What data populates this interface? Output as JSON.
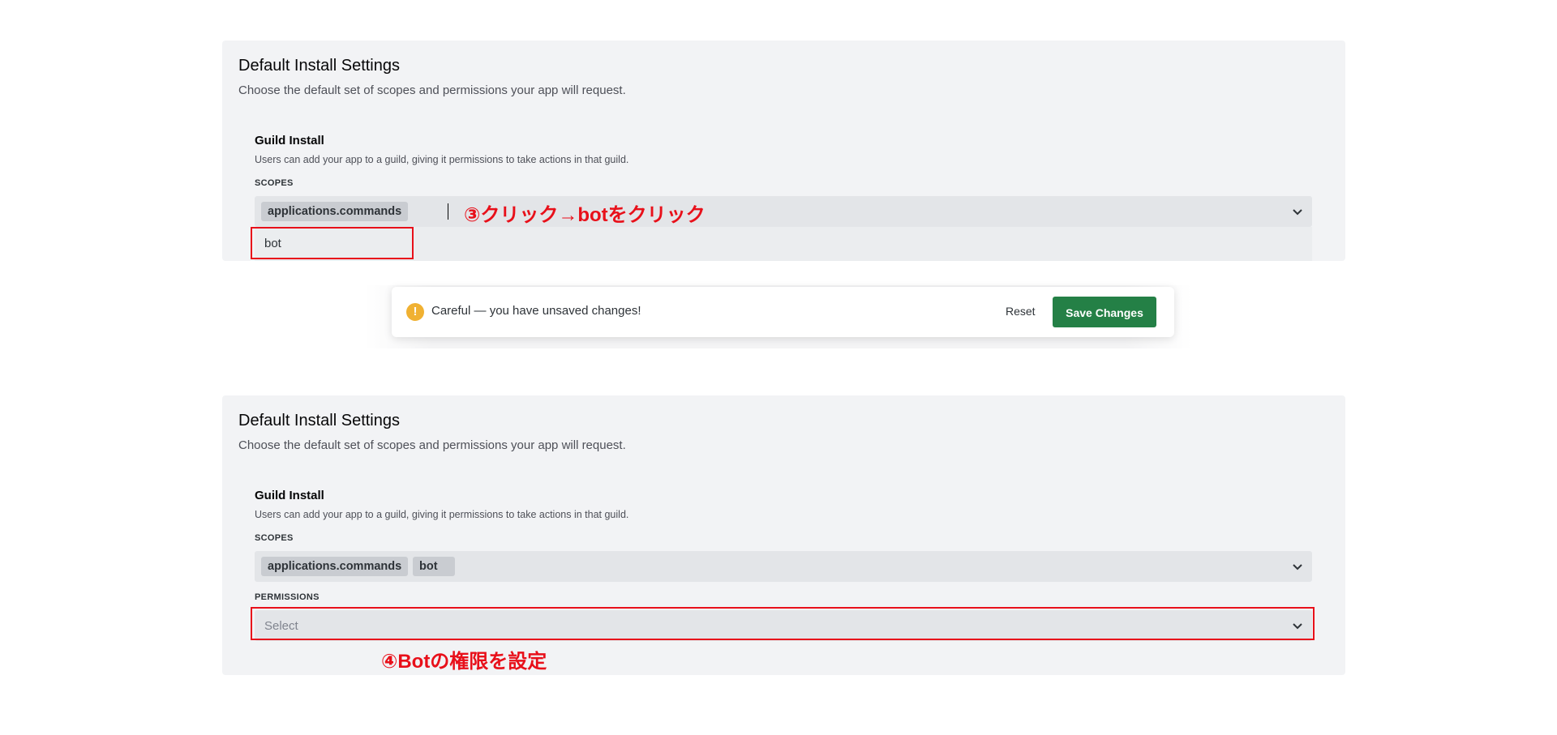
{
  "top_panel": {
    "title": "Default Install Settings",
    "subtitle": "Choose the default set of scopes and permissions your app will request.",
    "guild_title": "Guild Install",
    "guild_desc": "Users can add your app to a guild, giving it permissions to take actions in that guild.",
    "scopes_label": "SCOPES",
    "selected_tags": [
      "applications.commands"
    ],
    "dropdown_option": "bot"
  },
  "annotation_step3": "③クリック→botをクリック",
  "unsaved_bar": {
    "message": "Careful — you have unsaved changes!",
    "warning_glyph": "!",
    "reset_label": "Reset",
    "save_label": "Save Changes"
  },
  "bottom_panel": {
    "title": "Default Install Settings",
    "subtitle": "Choose the default set of scopes and permissions your app will request.",
    "guild_title": "Guild Install",
    "guild_desc": "Users can add your app to a guild, giving it permissions to take actions in that guild.",
    "scopes_label": "SCOPES",
    "selected_tags": [
      "applications.commands",
      "bot"
    ],
    "permissions_label": "PERMISSIONS",
    "permissions_placeholder": "Select"
  },
  "annotation_step4": "④Botの権限を設定",
  "colors": {
    "panel_bg": "#f2f3f5",
    "select_bg": "#e3e5e8",
    "annotation_red": "#e8101a",
    "save_green": "#248046",
    "warning_yellow": "#f0b132"
  },
  "icons": [
    "chevron-down-icon",
    "warning-icon"
  ]
}
